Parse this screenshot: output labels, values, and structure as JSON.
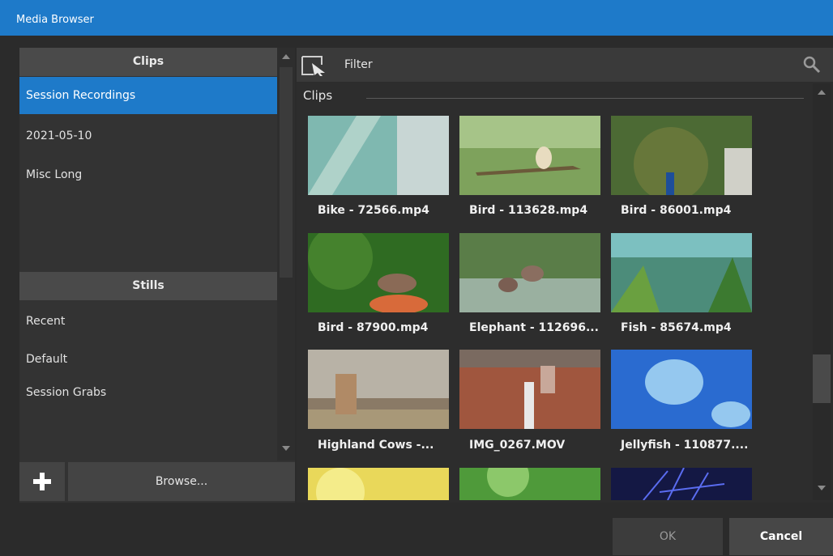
{
  "window": {
    "title": "Media Browser"
  },
  "left_panel": {
    "clips_header": "Clips",
    "clips_items": [
      {
        "label": "Session Recordings",
        "selected": true
      },
      {
        "label": "2021-05-10",
        "selected": false
      },
      {
        "label": "Misc Long",
        "selected": false
      }
    ],
    "stills_header": "Stills",
    "stills_items": [
      {
        "label": "Recent"
      },
      {
        "label": "Default"
      },
      {
        "label": "Session Grabs"
      }
    ],
    "add_icon": "plus-icon",
    "browse_label": "Browse..."
  },
  "right_panel": {
    "filter_icon": "cursor-select-icon",
    "filter_label": "Filter",
    "search_icon": "search-icon",
    "section_label": "Clips",
    "clips": [
      {
        "name": "Bike - 72566.mp4",
        "color": "#7fb8b0"
      },
      {
        "name": "Bird - 113628.mp4",
        "color": "#7ea25c"
      },
      {
        "name": "Bird - 86001.mp4",
        "color": "#4c6a34"
      },
      {
        "name": "Bird - 87900.mp4",
        "color": "#2f6b22"
      },
      {
        "name": "Elephant - 112696...",
        "color": "#5a7d48"
      },
      {
        "name": "Fish - 85674.mp4",
        "color": "#4c8c7a"
      },
      {
        "name": "Highland Cows -...",
        "color": "#8a7a66"
      },
      {
        "name": "IMG_0267.MOV",
        "color": "#a0563e"
      },
      {
        "name": "Jellyfish - 110877....",
        "color": "#2a6bd0"
      }
    ],
    "partial_row_colors": [
      "#e9d85a",
      "#4f9a3a",
      "#141844"
    ]
  },
  "footer": {
    "ok_label": "OK",
    "cancel_label": "Cancel"
  },
  "colors": {
    "accent": "#1e7ac9",
    "panel": "#333333",
    "header": "#4a4a4a"
  }
}
